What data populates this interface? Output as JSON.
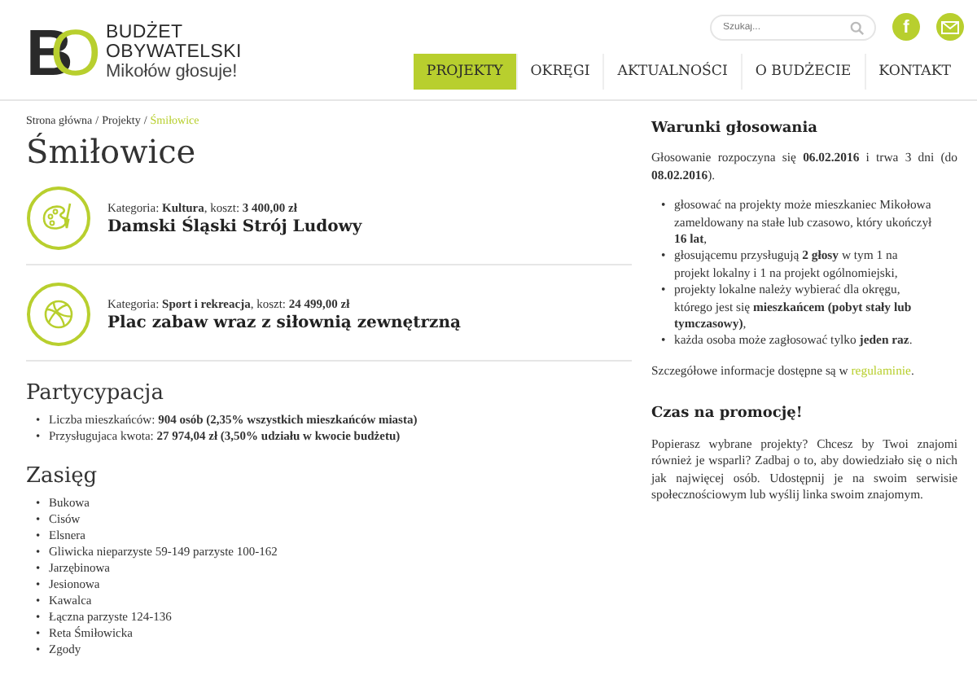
{
  "logo": {
    "mark_first": "B",
    "mark_second": "O",
    "line_1": "BUDŻET",
    "line_2": "OBYWATELSKI",
    "tagline": "Mikołów głosuje!"
  },
  "search": {
    "placeholder": "Szukaj..."
  },
  "social": {
    "facebook": "f"
  },
  "nav": [
    {
      "label": "PROJEKTY",
      "selected": true
    },
    {
      "label": "OKRĘGI",
      "selected": false
    },
    {
      "label": "AKTUALNOŚCI",
      "selected": false
    },
    {
      "label": "O BUDŻECIE",
      "selected": false
    },
    {
      "label": "KONTAKT",
      "selected": false
    }
  ],
  "breadcrumb": {
    "separator": "/",
    "items": [
      {
        "label": "Strona główna",
        "current": false
      },
      {
        "label": "Projekty",
        "current": false
      },
      {
        "label": "Śmiłowice",
        "current": true
      }
    ]
  },
  "title": "Śmiłowice",
  "projects": [
    {
      "kind": "palette",
      "meta": "Kategoria: **Kultura**, koszt: **3 400,00 zł**",
      "name": "Damski Śląski Strój Ludowy"
    },
    {
      "kind": "ball",
      "meta": "Kategoria: **Sport i rekreacja**, koszt: **24 499,00 zł**",
      "name": "Plac zabaw wraz z siłownią zewnętrzną"
    }
  ],
  "bullet": "•",
  "participation": {
    "heading": "Partycypacja",
    "items": [
      "Liczba mieszkańców: **904 osób (2,35% wszystkich mieszkańców miasta)**",
      "Przysługujaca kwota: **27 974,04 zł (3,50% udziału w kwocie budżetu)**"
    ]
  },
  "range": {
    "heading": "Zasięg",
    "items": [
      "Bukowa",
      "Cisów",
      "Elsnera",
      "Gliwicka nieparzyste 59-149 parzyste 100-162",
      "Jarzębinowa",
      "Jesionowa",
      "Kawalca",
      "Łączna parzyste 124-136",
      "Reta Śmiłowicka",
      "Zgody"
    ]
  },
  "voting": {
    "heading": "Warunki głosowania",
    "intro": "Głosowanie rozpoczyna się **06.02.2016** i trwa 3 dni (do **08.02.2016**).",
    "rules": [
      "głosować na projekty może mieszkaniec Mikołowa zameldowany na stałe lub czasowo, który ukończył **16 lat**,",
      "głosującemu przysługują **2 głosy** w tym 1 na projekt lokalny i 1 na projekt ogólnomiejski,",
      "projekty lokalne należy wybierać dla okręgu, którego jest się **mieszkańcem (pobyt stały lub tymczasowy)**,",
      "każda osoba może zagłosować tylko **jeden raz**."
    ],
    "details": "Szczegółowe informacje dostępne są w",
    "details_link": "regulaminie",
    "details_end": "."
  },
  "promo": {
    "heading": "Czas na promocję!",
    "text": "Popierasz wybrane projekty? Chcesz by Twoi znajomi również je wsparli? Zadbaj o to, aby dowiedziało się o nich jak najwięcej osób. Udostępnij je na swoim serwisie społecznościowym lub wyślij linka swoim znajomym."
  }
}
